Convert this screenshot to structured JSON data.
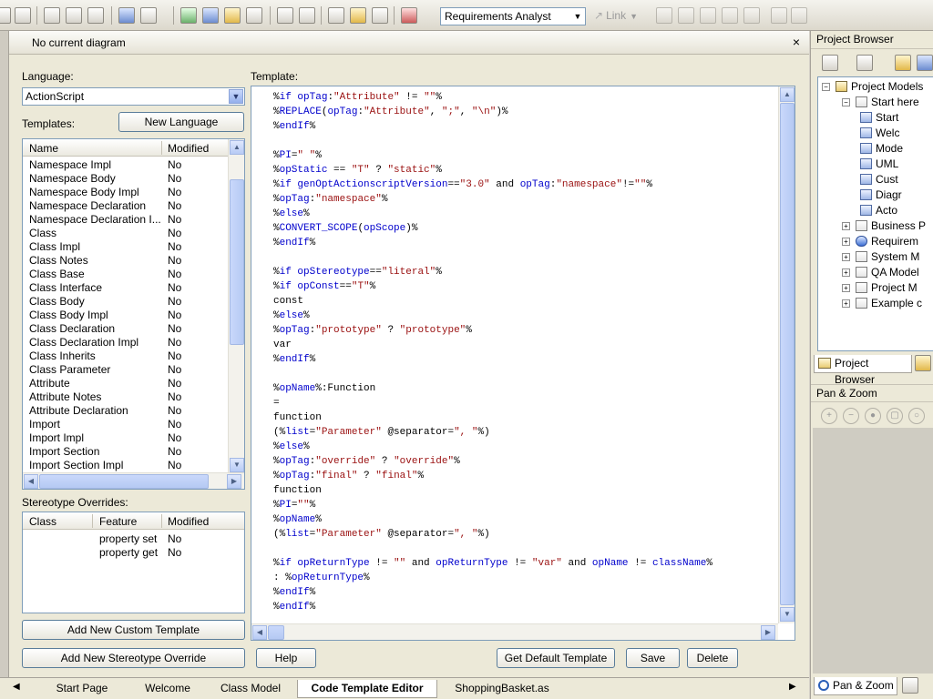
{
  "toolbar": {
    "role_combo": "Requirements Analyst",
    "link_label": "Link"
  },
  "editor": {
    "title": "No current diagram",
    "close_glyph": "×",
    "language_label": "Language:",
    "language_value": "ActionScript",
    "templates_label": "Templates:",
    "new_language_button": "New Language",
    "template_label": "Template:",
    "list_columns": [
      "Name",
      "Modified"
    ],
    "templates": [
      {
        "name": "Namespace Impl",
        "modified": "No"
      },
      {
        "name": "Namespace Body",
        "modified": "No"
      },
      {
        "name": "Namespace Body Impl",
        "modified": "No"
      },
      {
        "name": "Namespace Declaration",
        "modified": "No"
      },
      {
        "name": "Namespace Declaration I...",
        "modified": "No"
      },
      {
        "name": "Class",
        "modified": "No"
      },
      {
        "name": "Class Impl",
        "modified": "No"
      },
      {
        "name": "Class Notes",
        "modified": "No"
      },
      {
        "name": "Class Base",
        "modified": "No"
      },
      {
        "name": "Class Interface",
        "modified": "No"
      },
      {
        "name": "Class Body",
        "modified": "No"
      },
      {
        "name": "Class Body Impl",
        "modified": "No"
      },
      {
        "name": "Class Declaration",
        "modified": "No"
      },
      {
        "name": "Class Declaration Impl",
        "modified": "No"
      },
      {
        "name": "Class Inherits",
        "modified": "No"
      },
      {
        "name": "Class Parameter",
        "modified": "No"
      },
      {
        "name": "Attribute",
        "modified": "No"
      },
      {
        "name": "Attribute Notes",
        "modified": "No"
      },
      {
        "name": "Attribute Declaration",
        "modified": "No"
      },
      {
        "name": "Import",
        "modified": "No"
      },
      {
        "name": "Import Impl",
        "modified": "No"
      },
      {
        "name": "Import Section",
        "modified": "No"
      },
      {
        "name": "Import Section Impl",
        "modified": "No"
      }
    ],
    "stereotype_label": "Stereotype Overrides:",
    "stereo_columns": [
      "Class",
      "Feature",
      "Modified"
    ],
    "stereotypes": [
      {
        "class": "",
        "feature": "property set",
        "modified": "No"
      },
      {
        "class": "",
        "feature": "property get",
        "modified": "No"
      }
    ],
    "add_custom_button": "Add New Custom Template",
    "add_stereotype_button": "Add New Stereotype Override",
    "help_button": "Help",
    "get_default_button": "Get Default Template",
    "save_button": "Save",
    "delete_button": "Delete",
    "code_lines": [
      "%if opTag:\"Attribute\" != \"\"%",
      "%REPLACE(opTag:\"Attribute\", \";\", \"\\n\")%",
      "%endIf%",
      "",
      "%PI=\" \"%",
      "%opStatic == \"T\" ? \"static\"%",
      "%if genOptActionscriptVersion==\"3.0\" and opTag:\"namespace\"!=\"\"%",
      "%opTag:\"namespace\"%",
      "%else%",
      "%CONVERT_SCOPE(opScope)%",
      "%endIf%",
      "",
      "%if opStereotype==\"literal\"%",
      "%if opConst==\"T\"%",
      "const",
      "%else%",
      "%opTag:\"prototype\" ? \"prototype\"%",
      "var",
      "%endIf%",
      "",
      "%opName%:Function",
      "=",
      "function",
      "(%list=\"Parameter\" @separator=\", \"%)",
      "%else%",
      "%opTag:\"override\" ? \"override\"%",
      "%opTag:\"final\" ? \"final\"%",
      "function",
      "%PI=\"\"%",
      "%opName%",
      "(%list=\"Parameter\" @separator=\", \"%)",
      "",
      "%if opReturnType != \"\" and opReturnType != \"var\" and opName != className%",
      ": %opReturnType%",
      "%endIf%",
      "%endIf%"
    ]
  },
  "tabs": [
    "Start Page",
    "Welcome",
    "Class Model",
    "Code Template Editor",
    "ShoppingBasket.as"
  ],
  "active_tab": "Code Template Editor",
  "project_browser": {
    "title": "Project Browser",
    "tree": [
      {
        "label": "Project Models",
        "level": 0,
        "toggle": "-"
      },
      {
        "label": "Start here",
        "level": 1,
        "toggle": "-"
      },
      {
        "label": "Start",
        "level": 2,
        "toggle": ""
      },
      {
        "label": "Welc",
        "level": 2,
        "toggle": ""
      },
      {
        "label": "Mode",
        "level": 2,
        "toggle": ""
      },
      {
        "label": "UML",
        "level": 2,
        "toggle": ""
      },
      {
        "label": "Cust",
        "level": 2,
        "toggle": ""
      },
      {
        "label": "Diagr",
        "level": 2,
        "toggle": ""
      },
      {
        "label": "Acto",
        "level": 2,
        "toggle": ""
      },
      {
        "label": "Business P",
        "level": 1,
        "toggle": "+"
      },
      {
        "label": "Requirem",
        "level": 1,
        "toggle": "+"
      },
      {
        "label": "System M",
        "level": 1,
        "toggle": "+"
      },
      {
        "label": "QA Model",
        "level": 1,
        "toggle": "+"
      },
      {
        "label": "Project M",
        "level": 1,
        "toggle": "+"
      },
      {
        "label": "Example c",
        "level": 1,
        "toggle": "+"
      }
    ],
    "tab_label": "Project Browser"
  },
  "pan_zoom": {
    "title": "Pan & Zoom",
    "tab_label": "Pan & Zoom"
  }
}
